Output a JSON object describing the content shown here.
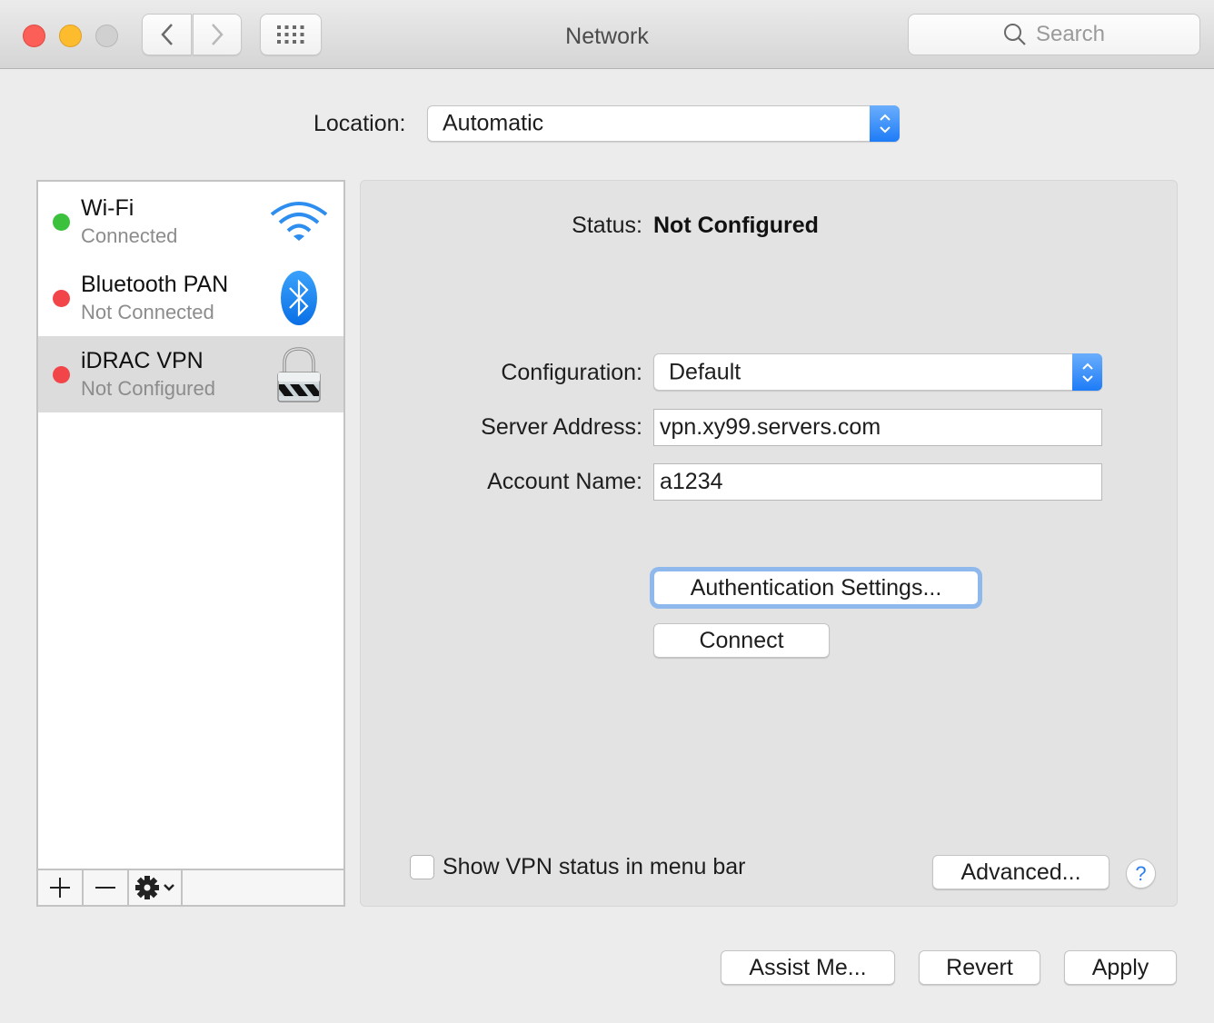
{
  "window": {
    "title": "Network",
    "search_placeholder": "Search"
  },
  "location": {
    "label": "Location:",
    "value": "Automatic"
  },
  "services": [
    {
      "name": "Wi-Fi",
      "status": "Connected",
      "status_color": "#3cc13c",
      "icon": "wifi-icon",
      "selected": false
    },
    {
      "name": "Bluetooth PAN",
      "status": "Not Connected",
      "status_color": "#f2454a",
      "icon": "bluetooth-icon",
      "selected": false
    },
    {
      "name": "iDRAC VPN",
      "status": "Not Configured",
      "status_color": "#f2454a",
      "icon": "vpn-lock-icon",
      "selected": true
    }
  ],
  "sidebar_toolbar": {
    "add": "+",
    "remove": "—",
    "action": "gear-icon"
  },
  "detail": {
    "status_label": "Status:",
    "status_value": "Not Configured",
    "configuration_label": "Configuration:",
    "configuration_value": "Default",
    "server_label": "Server Address:",
    "server_value": "vpn.xy99.servers.com",
    "account_label": "Account Name:",
    "account_value": "a1234",
    "auth_button": "Authentication Settings...",
    "connect_button": "Connect",
    "show_vpn_label": "Show VPN status in menu bar",
    "show_vpn_checked": false,
    "advanced_button": "Advanced...",
    "help": "?"
  },
  "footer": {
    "assist": "Assist Me...",
    "revert": "Revert",
    "apply": "Apply"
  },
  "colors": {
    "accent": "#1e7cf7",
    "focus_ring": "#8fb9ed"
  }
}
